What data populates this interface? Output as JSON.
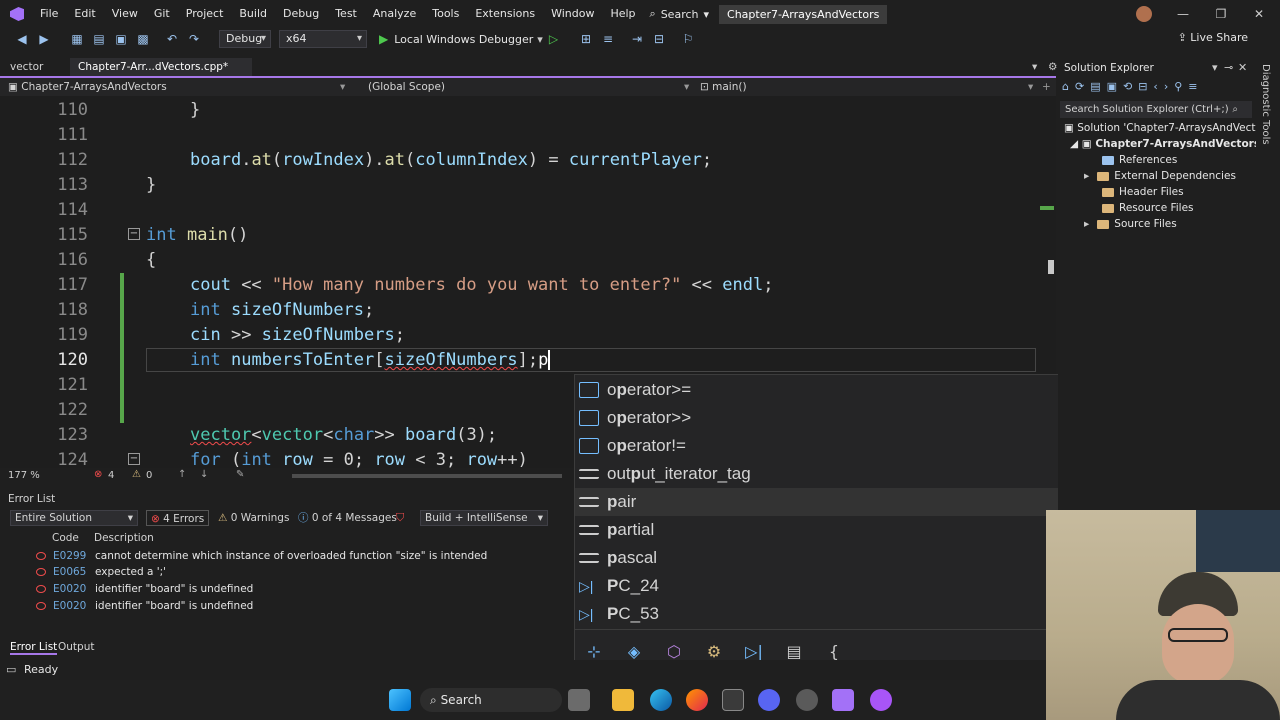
{
  "menu": [
    "File",
    "Edit",
    "View",
    "Git",
    "Project",
    "Build",
    "Debug",
    "Test",
    "Analyze",
    "Tools",
    "Extensions",
    "Window",
    "Help"
  ],
  "search_label": "Search",
  "solution_name": "Chapter7-ArraysAndVectors",
  "toolbar": {
    "config": "Debug",
    "platform": "x64",
    "debugger": "Local Windows Debugger",
    "live_share": "Live Share"
  },
  "tabs": [
    {
      "label": "vector"
    },
    {
      "label": "Chapter7-Arr...dVectors.cpp*"
    }
  ],
  "navbar": {
    "project": "Chapter7-ArraysAndVectors",
    "scope": "(Global Scope)",
    "member": "main()"
  },
  "code_lines": [
    {
      "num": "110"
    },
    {
      "num": "111"
    },
    {
      "num": "112"
    },
    {
      "num": "113"
    },
    {
      "num": "114"
    },
    {
      "num": "115"
    },
    {
      "num": "116"
    },
    {
      "num": "117"
    },
    {
      "num": "118"
    },
    {
      "num": "119"
    },
    {
      "num": "120"
    },
    {
      "num": "121"
    },
    {
      "num": "122"
    },
    {
      "num": "123"
    },
    {
      "num": "124"
    }
  ],
  "code": {
    "l110": "}",
    "l112": [
      "board",
      ".",
      "at",
      "(",
      "rowIndex",
      ").",
      "at",
      "(",
      "columnIndex",
      ") = ",
      "currentPlayer",
      ";"
    ],
    "l113": "}",
    "l115": [
      "int",
      " ",
      "main",
      "()"
    ],
    "l116": "{",
    "l117": [
      "cout",
      " << ",
      "\"How many numbers do you want to enter?\"",
      " << ",
      "endl",
      ";"
    ],
    "l118": [
      "int",
      " ",
      "sizeOfNumbers",
      ";"
    ],
    "l119": [
      "cin",
      " >> ",
      "sizeOfNumbers",
      ";"
    ],
    "l120": [
      "int",
      " ",
      "numbersToEnter",
      "[",
      "sizeOfNumbers",
      "];",
      "p"
    ],
    "l123": [
      "vector",
      "<",
      "vector",
      "<",
      "char",
      ">> ",
      "board",
      "(3);"
    ],
    "l124": [
      "for",
      " (",
      "int",
      " ",
      "row",
      " = 0; ",
      "row",
      " < 3; ",
      "row",
      "++)"
    ]
  },
  "editor_status": {
    "zoom": "177 %",
    "errors": "4",
    "warnings": "0"
  },
  "completion": [
    {
      "prefix": "o",
      "bold": "p",
      "rest": "erator>=",
      "icon": "operator"
    },
    {
      "prefix": "o",
      "bold": "p",
      "rest": "erator>>",
      "icon": "operator"
    },
    {
      "prefix": "o",
      "bold": "p",
      "rest": "erator!=",
      "icon": "operator"
    },
    {
      "prefix": "out",
      "bold": "p",
      "rest": "ut_iterator_tag",
      "icon": "class"
    },
    {
      "prefix": "",
      "bold": "p",
      "rest": "air",
      "icon": "class"
    },
    {
      "prefix": "",
      "bold": "p",
      "rest": "artial",
      "icon": "keyword"
    },
    {
      "prefix": "",
      "bold": "p",
      "rest": "ascal",
      "icon": "keyword"
    },
    {
      "prefix": "",
      "bold": "P",
      "rest": "C_24",
      "icon": "macro"
    },
    {
      "prefix": "",
      "bold": "P",
      "rest": "C_53",
      "icon": "macro"
    }
  ],
  "solution_explorer": {
    "title": "Solution Explorer",
    "search_placeholder": "Search Solution Explorer (Ctrl+;)",
    "solution": "Solution 'Chapter7-ArraysAndVectors",
    "project": "Chapter7-ArraysAndVectors",
    "items": [
      "References",
      "External Dependencies",
      "Header Files",
      "Resource Files",
      "Source Files"
    ],
    "side_tab": "Diagnostic Tools"
  },
  "error_list": {
    "title": "Error List",
    "scope": "Entire Solution",
    "errors_btn": "4 Errors",
    "warnings_btn": "0 Warnings",
    "messages_btn": "0 of 4 Messages",
    "build_filter": "Build + IntelliSense",
    "col_code": "Code",
    "col_desc": "Description",
    "rows": [
      {
        "code": "E0299",
        "desc": "cannot determine which instance of overloaded function \"size\" is intended"
      },
      {
        "code": "E0065",
        "desc": "expected a ';'"
      },
      {
        "code": "E0020",
        "desc": "identifier \"board\" is undefined"
      },
      {
        "code": "E0020",
        "desc": "identifier \"board\" is undefined"
      }
    ]
  },
  "bottom_tabs": [
    "Error List",
    "Output"
  ],
  "status": "Ready",
  "taskbar_search": "Search",
  "colors": {
    "accent": "#a677e8",
    "error": "#f14c4c",
    "keyword": "#569cd6",
    "string": "#d69d85",
    "type": "#4ec9b0"
  }
}
